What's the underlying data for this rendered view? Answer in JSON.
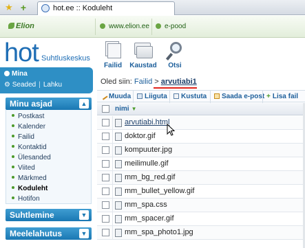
{
  "browser": {
    "tab_title": "hot.ee :: Koduleht"
  },
  "topbar": {
    "brand": "Elion",
    "links": [
      "www.elion.ee",
      "e-pood"
    ]
  },
  "sidebar": {
    "logo": "hot",
    "logo_sub": "Suhtluskeskus",
    "user": {
      "label": "Mina",
      "settings": "Seaded",
      "logout": "Lahku"
    },
    "sections": [
      {
        "title": "Minu asjad",
        "chevron": "up"
      },
      {
        "title": "Suhtlemine",
        "chevron": "down"
      },
      {
        "title": "Meelelahutus",
        "chevron": "down"
      }
    ],
    "items": [
      "Postkast",
      "Kalender",
      "Failid",
      "Kontaktid",
      "Ülesanded",
      "Viited",
      "Märkmed",
      "Koduleht",
      "Hotifon"
    ],
    "active_item": "Koduleht"
  },
  "toolbar": {
    "buttons": [
      {
        "label": "Failid",
        "icon": "files-icon"
      },
      {
        "label": "Kaustad",
        "icon": "folders-icon"
      },
      {
        "label": "Otsi",
        "icon": "search-icon"
      }
    ]
  },
  "breadcrumb": {
    "prefix": "Oled siin:",
    "root": "Failid",
    "separator": ">",
    "current": "arvutiabi1"
  },
  "actions": [
    "Muuda",
    "Liiguta",
    "Kustuta",
    "Saada e-post",
    "Lisa fail"
  ],
  "table": {
    "header": "nimi",
    "sort_indicator": "▼",
    "files": [
      "arvutiabi.html",
      "doktor.gif",
      "kompuuter.jpg",
      "meilimulle.gif",
      "mm_bg_red.gif",
      "mm_bullet_yellow.gif",
      "mm_spa.css",
      "mm_spacer.gif",
      "mm_spa_photo1.jpg"
    ]
  },
  "colors": {
    "accent_blue": "#1d5f9b",
    "section_blue": "#1a78b3",
    "brand_green": "#4c9a2a",
    "highlight_red": "#e2231a"
  }
}
